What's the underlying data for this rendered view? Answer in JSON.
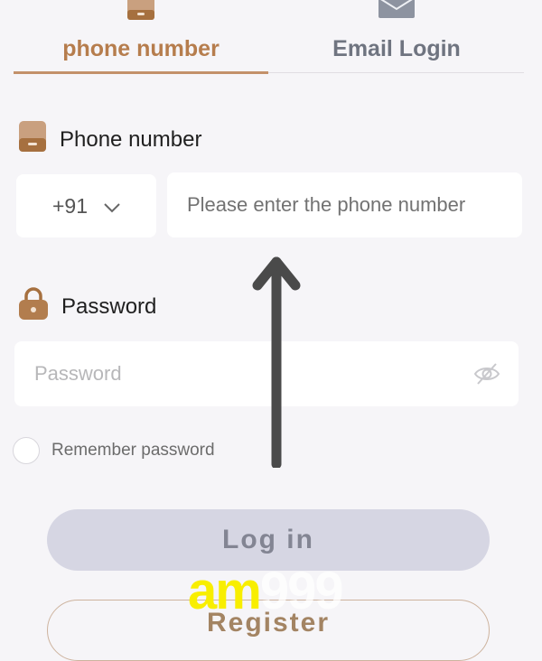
{
  "tabs": {
    "phone": {
      "label": "phone number",
      "icon": "phone-icon",
      "active": true
    },
    "email": {
      "label": "Email Login",
      "icon": "mail-icon",
      "active": false
    }
  },
  "phone_section": {
    "label": "Phone number",
    "icon": "phone-icon",
    "country_code": "+91",
    "code_icon": "chevron-down-icon",
    "placeholder": "Please enter the phone number",
    "value": ""
  },
  "password_section": {
    "label": "Password",
    "icon": "lock-icon",
    "placeholder": "Password",
    "value": "",
    "visibility_icon": "eye-off-icon"
  },
  "remember": {
    "label": "Remember password",
    "checked": false
  },
  "buttons": {
    "login": "Log in",
    "register": "Register"
  },
  "watermark": {
    "part1": "am",
    "part2": "999"
  },
  "annotation": {
    "icon": "arrow-up-icon"
  },
  "colors": {
    "accent": "#b67d4d",
    "background": "#f6f5f8",
    "login_button_bg": "#d6d6e3",
    "watermark_yellow": "#f8ee00"
  }
}
